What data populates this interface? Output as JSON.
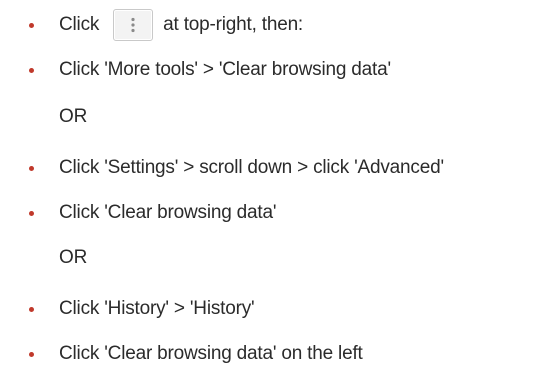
{
  "items": [
    {
      "type": "bullet",
      "text_before": "Click",
      "icon": "vertical-dots-menu-icon",
      "text_after": "at top-right, then:"
    },
    {
      "type": "bullet",
      "text": "Click 'More tools' > 'Clear browsing data'"
    },
    {
      "type": "plain",
      "text": "OR"
    },
    {
      "type": "bullet",
      "text": "Click 'Settings' > scroll down > click 'Advanced'"
    },
    {
      "type": "bullet",
      "text": "Click 'Clear browsing data'"
    },
    {
      "type": "plain",
      "text": "OR"
    },
    {
      "type": "bullet",
      "text": "Click 'History' > 'History'"
    },
    {
      "type": "bullet",
      "text": "Click 'Clear browsing data' on the left"
    }
  ],
  "colors": {
    "bullet": "#c0392b",
    "text": "#2b2b2b",
    "button_bg": "#f3f3f3",
    "button_border": "#c9c9c9",
    "dots": "#8a8a8a"
  }
}
